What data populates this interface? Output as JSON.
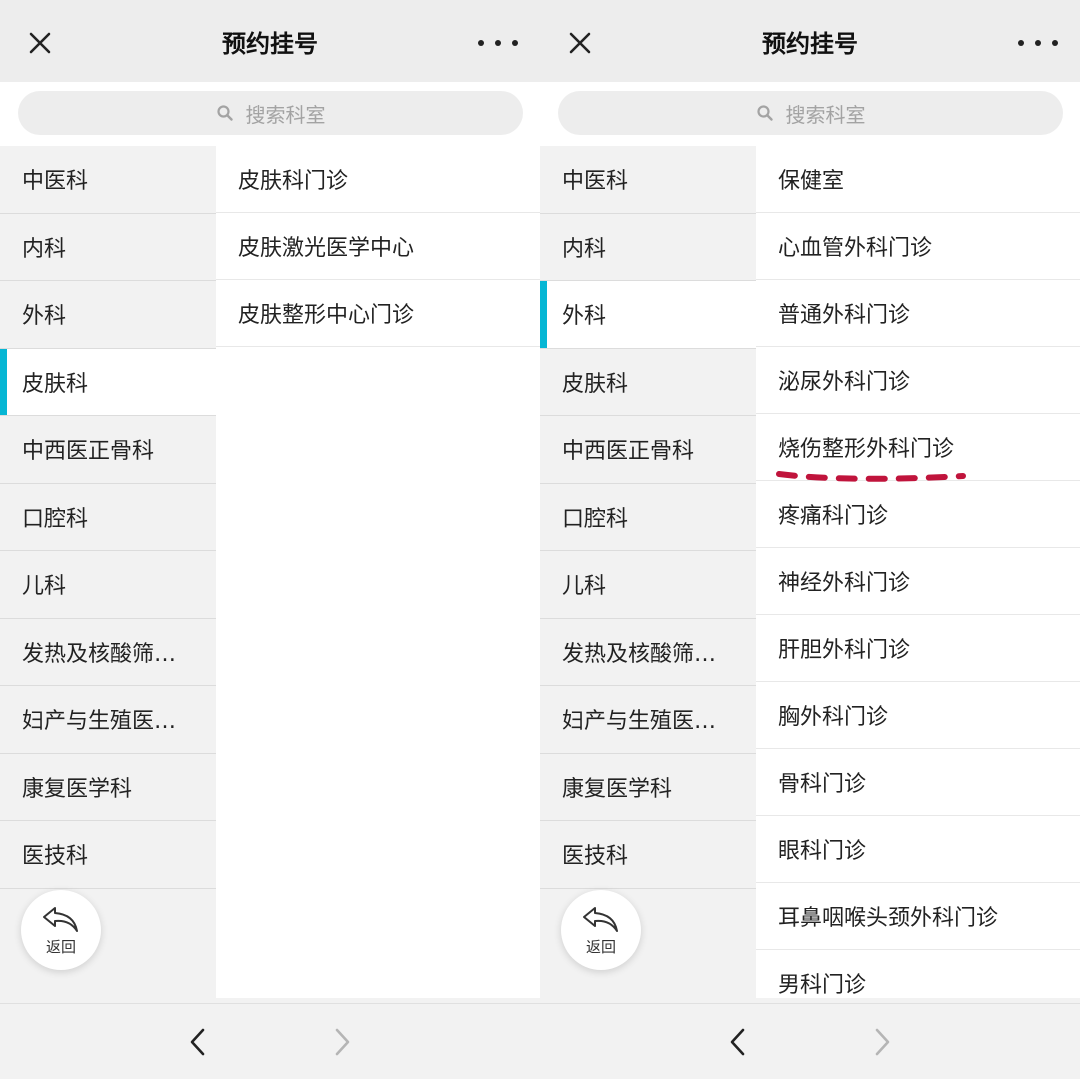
{
  "left": {
    "title": "预约挂号",
    "search_placeholder": "搜索科室",
    "departments": [
      "中医科",
      "内科",
      "外科",
      "皮肤科",
      "中西医正骨科",
      "口腔科",
      "儿科",
      "发热及核酸筛…",
      "妇产与生殖医…",
      "康复医学科",
      "医技科"
    ],
    "selected_department": "皮肤科",
    "clinics": [
      "皮肤科门诊",
      "皮肤激光医学中心",
      "皮肤整形中心门诊"
    ],
    "back_label": "返回"
  },
  "right": {
    "title": "预约挂号",
    "search_placeholder": "搜索科室",
    "departments": [
      "中医科",
      "内科",
      "外科",
      "皮肤科",
      "中西医正骨科",
      "口腔科",
      "儿科",
      "发热及核酸筛…",
      "妇产与生殖医…",
      "康复医学科",
      "医技科"
    ],
    "selected_department": "外科",
    "clinics": [
      "保健室",
      "心血管外科门诊",
      "普通外科门诊",
      "泌尿外科门诊",
      "烧伤整形外科门诊",
      "疼痛科门诊",
      "神经外科门诊",
      "肝胆外科门诊",
      "胸外科门诊",
      "骨科门诊",
      "眼科门诊",
      "耳鼻咽喉头颈外科门诊",
      "男科门诊"
    ],
    "highlighted_clinic": "烧伤整形外科门诊",
    "back_label": "返回"
  },
  "colors": {
    "accent": "#06b6d4",
    "annotation": "#c0143c"
  },
  "icons": [
    "close-icon",
    "more-icon",
    "search-icon",
    "back-arrow-icon",
    "chevron-left-icon",
    "chevron-right-icon"
  ]
}
